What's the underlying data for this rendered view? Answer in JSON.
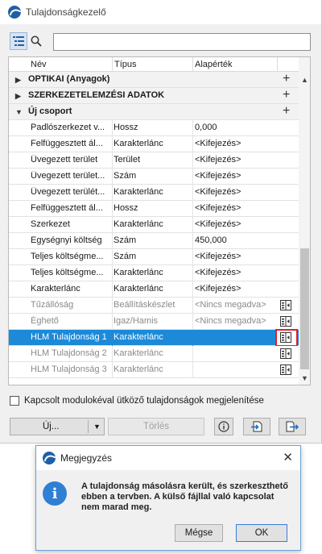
{
  "window": {
    "title": "Tulajdonságkezelő"
  },
  "toolbar": {
    "list_icon": "list-view-icon",
    "search_icon": "search-icon",
    "search_value": ""
  },
  "table": {
    "headers": {
      "name": "Név",
      "type": "Típus",
      "default": "Alapérték"
    },
    "groups": [
      {
        "label": "OPTIKAI (Anyagok)",
        "expanded": false
      },
      {
        "label": "SZERKEZETELEMZÉSI ADATOK",
        "expanded": false
      },
      {
        "label": "Új csoport",
        "expanded": true
      }
    ],
    "rows": [
      {
        "name": "Padlószerkezet v...",
        "type": "Hossz",
        "default": "0,000"
      },
      {
        "name": "Felfüggesztett ál...",
        "type": "Karakterlánc",
        "default": "<Kifejezés>"
      },
      {
        "name": "Üvegezett terület",
        "type": "Terület",
        "default": "<Kifejezés>"
      },
      {
        "name": "Üvegezett terület...",
        "type": "Szám",
        "default": "<Kifejezés>"
      },
      {
        "name": "Üvegezett terülét...",
        "type": "Karakterlánc",
        "default": "<Kifejezés>"
      },
      {
        "name": "Felfüggesztett ál...",
        "type": "Hossz",
        "default": "<Kifejezés>"
      },
      {
        "name": "Szerkezet",
        "type": "Karakterlánc",
        "default": "<Kifejezés>"
      },
      {
        "name": "Egységnyi költség",
        "type": "Szám",
        "default": "450,000"
      },
      {
        "name": "Teljes költségme...",
        "type": "Szám",
        "default": "<Kifejezés>"
      },
      {
        "name": "Teljes költségme...",
        "type": "Karakterlánc",
        "default": "<Kifejezés>"
      },
      {
        "name": "Karakterlánc",
        "type": "Karakterlánc",
        "default": "<Kifejezés>"
      },
      {
        "name": "Tűzállóság",
        "type": "Beállításkészlet",
        "default": "<Nincs megadva>",
        "linked": true
      },
      {
        "name": "Éghető",
        "type": "Igaz/Hamis",
        "default": "<Nincs megadva>",
        "linked": true
      },
      {
        "name": "HLM Tulajdonság 1",
        "type": "Karakterlánc",
        "default": "",
        "linked": true,
        "selected": true
      },
      {
        "name": "HLM Tulajdonság 2",
        "type": "Karakterlánc",
        "default": "",
        "linked": true
      },
      {
        "name": "HLM Tulajdonság 3",
        "type": "Karakterlánc",
        "default": "",
        "linked": true
      }
    ]
  },
  "bottom": {
    "checkbox_label": "Kapcsolt modulokéval ütköző tulajdonságok megjelenítése",
    "new_button": "Új...",
    "delete_button": "Törlés",
    "info_icon": "info-icon",
    "import_icon": "import-icon",
    "export_icon": "export-icon"
  },
  "dialog": {
    "title": "Megjegyzés",
    "message": "A tulajdonság másolásra került, és szerkeszthető ebben a tervben. A külső fájllal való kapcsolat nem marad meg.",
    "cancel_label": "Mégse",
    "ok_label": "OK"
  },
  "colors": {
    "selection": "#1c8ad8",
    "highlight": "#e0202a",
    "accent": "#1f5fa6"
  }
}
